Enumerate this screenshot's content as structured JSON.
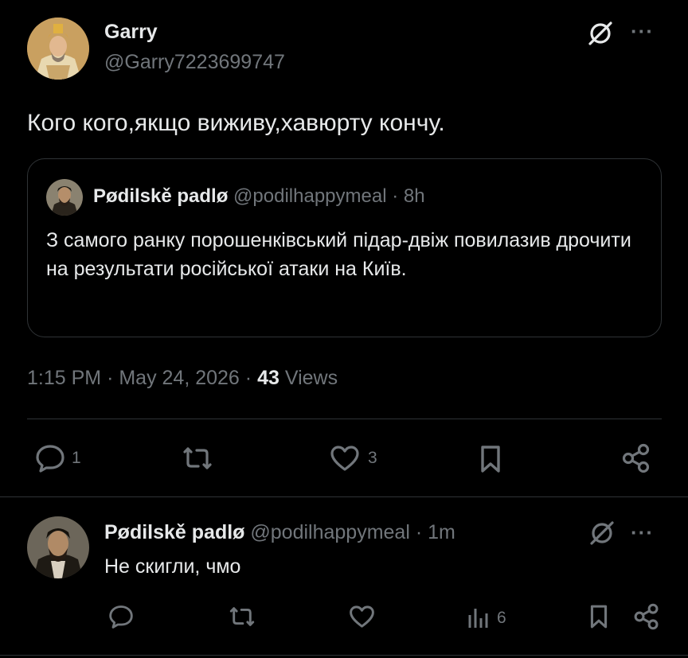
{
  "main_post": {
    "author_name": "Garry",
    "author_handle": "@Garry7223699747",
    "text": "Кого кого,якщо виживу,хавюрту кончу.",
    "quoted": {
      "author_name": "Pødilskě padlø",
      "author_handle": "@podilhappymeal",
      "separator": "·",
      "time": "8h",
      "text": "З самого ранку порошенківський підар-двіж повилазив дрочити на результати російської атаки на Київ."
    },
    "meta": {
      "time": "1:15 PM",
      "sep1": "·",
      "date": "May 24, 2026",
      "sep2": "·",
      "views_count": "43",
      "views_label": "Views"
    },
    "actions": {
      "reply_count": "1",
      "like_count": "3"
    }
  },
  "reply_post": {
    "author_name": "Pødilskě padlø",
    "author_handle": "@podilhappymeal",
    "separator": "·",
    "time": "1m",
    "text": "Не скигли, чмо",
    "actions": {
      "views_count": "6"
    }
  },
  "more_label": "···",
  "colors": {
    "background": "#000000",
    "text": "#e7e9ea",
    "muted": "#71767b",
    "border": "#2f3336"
  }
}
